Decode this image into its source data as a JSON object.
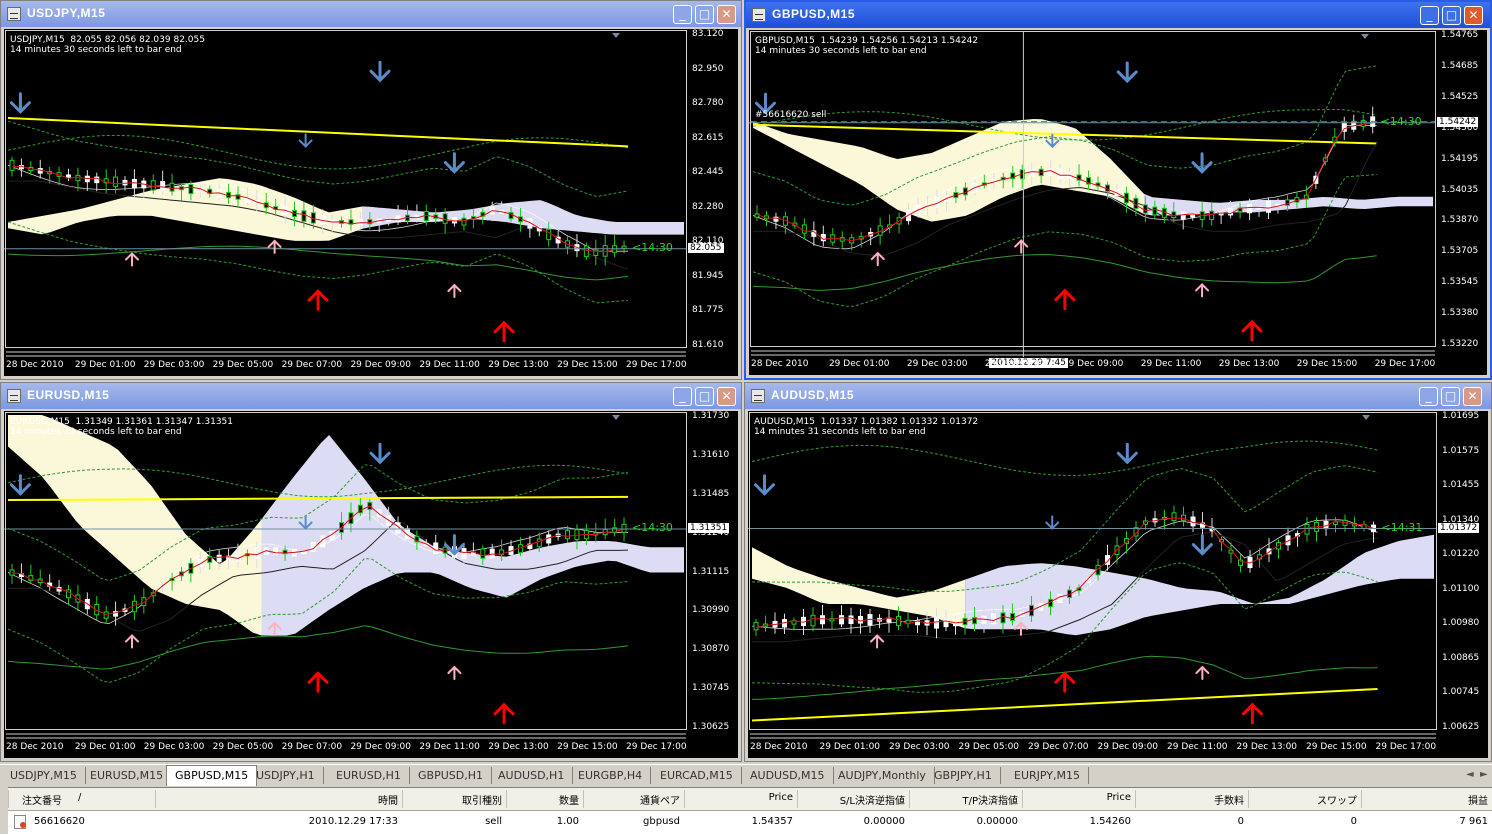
{
  "windows": [
    {
      "id": "usdjpy",
      "title": "USDJPY,M15",
      "active": false,
      "info_line1": "USDJPY,M15  82.055 82.056 82.039 82.055",
      "info_line2": "14 minutes 30 seconds left to bar end",
      "current_price": "82.055",
      "timer": "<14:30",
      "price_labels": [
        "83.120",
        "82.950",
        "82.780",
        "82.615",
        "82.445",
        "82.280",
        "82.110",
        "81.945",
        "81.775",
        "81.610"
      ],
      "time_labels": [
        "28 Dec 2010",
        "29 Dec 01:00",
        "29 Dec 03:00",
        "29 Dec 05:00",
        "29 Dec 07:00",
        "29 Dec 09:00",
        "29 Dec 11:00",
        "29 Dec 13:00",
        "29 Dec 15:00",
        "29 Dec 17:00"
      ],
      "order_label": "",
      "crosshair_time": ""
    },
    {
      "id": "gbpusd",
      "title": "GBPUSD,M15",
      "active": true,
      "info_line1": "GBPUSD,M15  1.54239 1.54256 1.54213 1.54242",
      "info_line2": "14 minutes 30 seconds left to bar end",
      "current_price": "1.54242",
      "timer": "<14:30",
      "price_labels": [
        "1.54765",
        "1.54685",
        "1.54525",
        "1.54360",
        "1.54195",
        "1.54035",
        "1.53870",
        "1.53705",
        "1.53545",
        "1.53380",
        "1.53220"
      ],
      "time_labels": [
        "28 Dec 2010",
        "29 Dec 01:00",
        "29 Dec 03:00",
        "29 Dec 05:00",
        "29 Dec 09:00",
        "29 Dec 11:00",
        "29 Dec 13:00",
        "29 Dec 15:00",
        "29 Dec 17:00"
      ],
      "order_label": "#56616620 sell",
      "crosshair_time": "2010.12.29 7:45"
    },
    {
      "id": "eurusd",
      "title": "EURUSD,M15",
      "active": false,
      "info_line1": "EURUSD,M15  1.31349 1.31361 1.31347 1.31351",
      "info_line2": "14 minutes 30 seconds left to bar end",
      "current_price": "1.31351",
      "timer": "<14:30",
      "price_labels": [
        "1.31730",
        "1.31610",
        "1.31485",
        "1.31240",
        "1.31115",
        "1.30990",
        "1.30870",
        "1.30745",
        "1.30625"
      ],
      "time_labels": [
        "28 Dec 2010",
        "29 Dec 01:00",
        "29 Dec 03:00",
        "29 Dec 05:00",
        "29 Dec 07:00",
        "29 Dec 09:00",
        "29 Dec 11:00",
        "29 Dec 13:00",
        "29 Dec 15:00",
        "29 Dec 17:00"
      ],
      "order_label": "",
      "crosshair_time": ""
    },
    {
      "id": "audusd",
      "title": "AUDUSD,M15",
      "active": false,
      "info_line1": "AUDUSD,M15  1.01337 1.01382 1.01332 1.01372",
      "info_line2": "14 minutes 31 seconds left to bar end",
      "current_price": "1.01372",
      "timer": "<14:31",
      "price_labels": [
        "1.01695",
        "1.01575",
        "1.01455",
        "1.01340",
        "1.01220",
        "1.01100",
        "1.00980",
        "1.00865",
        "1.00745",
        "1.00625"
      ],
      "time_labels": [
        "28 Dec 2010",
        "29 Dec 01:00",
        "29 Dec 03:00",
        "29 Dec 05:00",
        "29 Dec 07:00",
        "29 Dec 09:00",
        "29 Dec 11:00",
        "29 Dec 13:00",
        "29 Dec 15:00",
        "29 Dec 17:00"
      ],
      "order_label": "",
      "crosshair_time": ""
    }
  ],
  "tabs": [
    "USDJPY,M15",
    "EURUSD,M15",
    "GBPUSD,M15",
    "USDJPY,H1",
    "EURUSD,H1",
    "GBPUSD,H1",
    "AUDUSD,H1",
    "EURGBP,H4",
    "EURCAD,M15",
    "AUDUSD,M15",
    "AUDJPY,Monthly",
    "GBPJPY,H1",
    "EURJPY,M15"
  ],
  "selected_tab": "GBPUSD,M15",
  "orders": {
    "headers": [
      "注文番号",
      "時間",
      "取引種別",
      "数量",
      "通貨ペア",
      "Price",
      "S/L決済逆指値",
      "T/P決済指値",
      "Price",
      "手数料",
      "スワップ",
      "損益"
    ],
    "sort_indicator": "/",
    "rows": [
      [
        "56616620",
        "2010.12.29 17:33",
        "sell",
        "1.00",
        "gbpusd",
        "1.54357",
        "0.00000",
        "0.00000",
        "1.54260",
        "0",
        "0",
        "7 961"
      ]
    ]
  },
  "colors": {
    "bull": "#22cc22",
    "bear": "#f8f8f8",
    "kumo_a": "#fbf8da",
    "kumo_b": "#dcdcf4",
    "sma_long": "#ffff00",
    "arrow_up": "#ff0000",
    "arrow_pink": "#ffb0c0",
    "arrow_blue": "#5a8ccc",
    "timer": "#2ad42a"
  }
}
